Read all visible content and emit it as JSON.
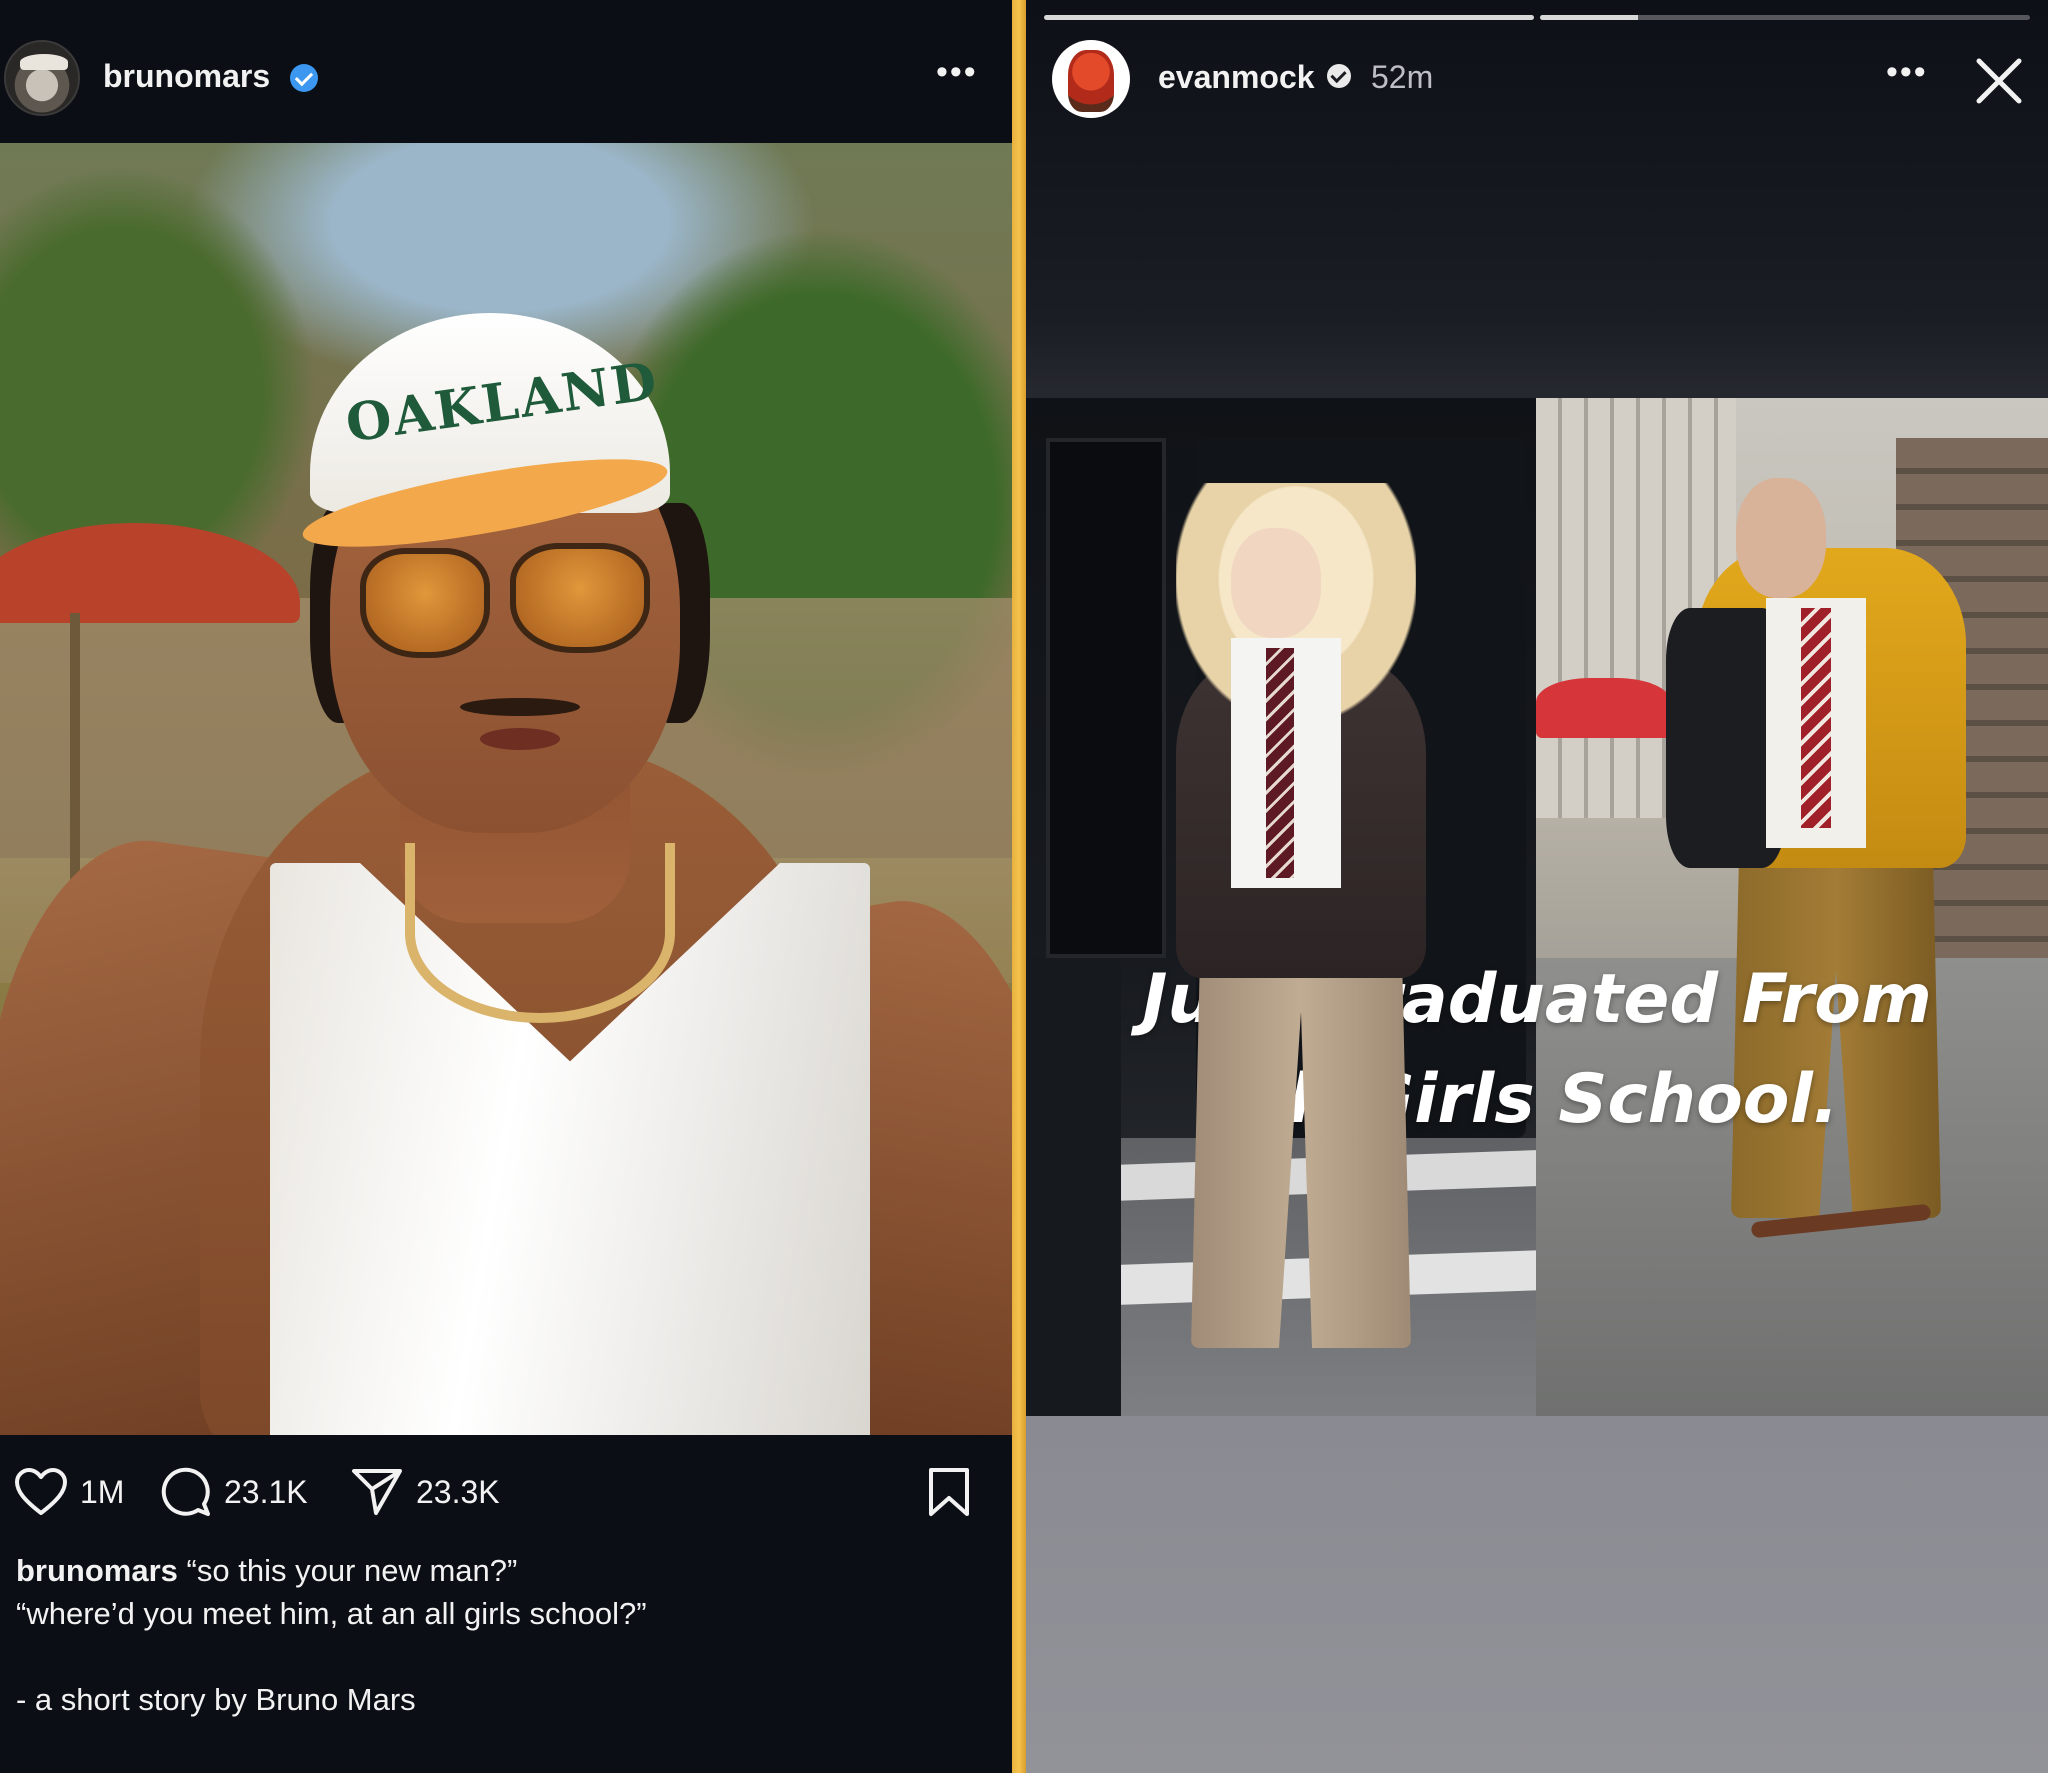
{
  "post": {
    "username": "brunomars",
    "more_label": "•••",
    "cap_text": "OAKLAND",
    "likes": "1M",
    "comments": "23.1K",
    "shares": "23.3K",
    "caption": {
      "user": "brunomars",
      "line1": "“so this your new man?”",
      "line2": "“where’d you meet him, at an all girls school?”",
      "line3": "- a short story by Bruno Mars"
    }
  },
  "story": {
    "username": "evanmock",
    "time": "52m",
    "more_label": "•••",
    "progress": [
      1.0,
      0.2
    ],
    "caption_line1": "Just Graduated From",
    "caption_line2": "All Girls School."
  },
  "colors": {
    "divider": "#f6c24f",
    "verified_blue": "#3b97f0"
  },
  "icons": [
    "heart-icon",
    "comment-icon",
    "share-icon",
    "bookmark-icon",
    "more-icon",
    "close-icon",
    "verified-icon"
  ]
}
